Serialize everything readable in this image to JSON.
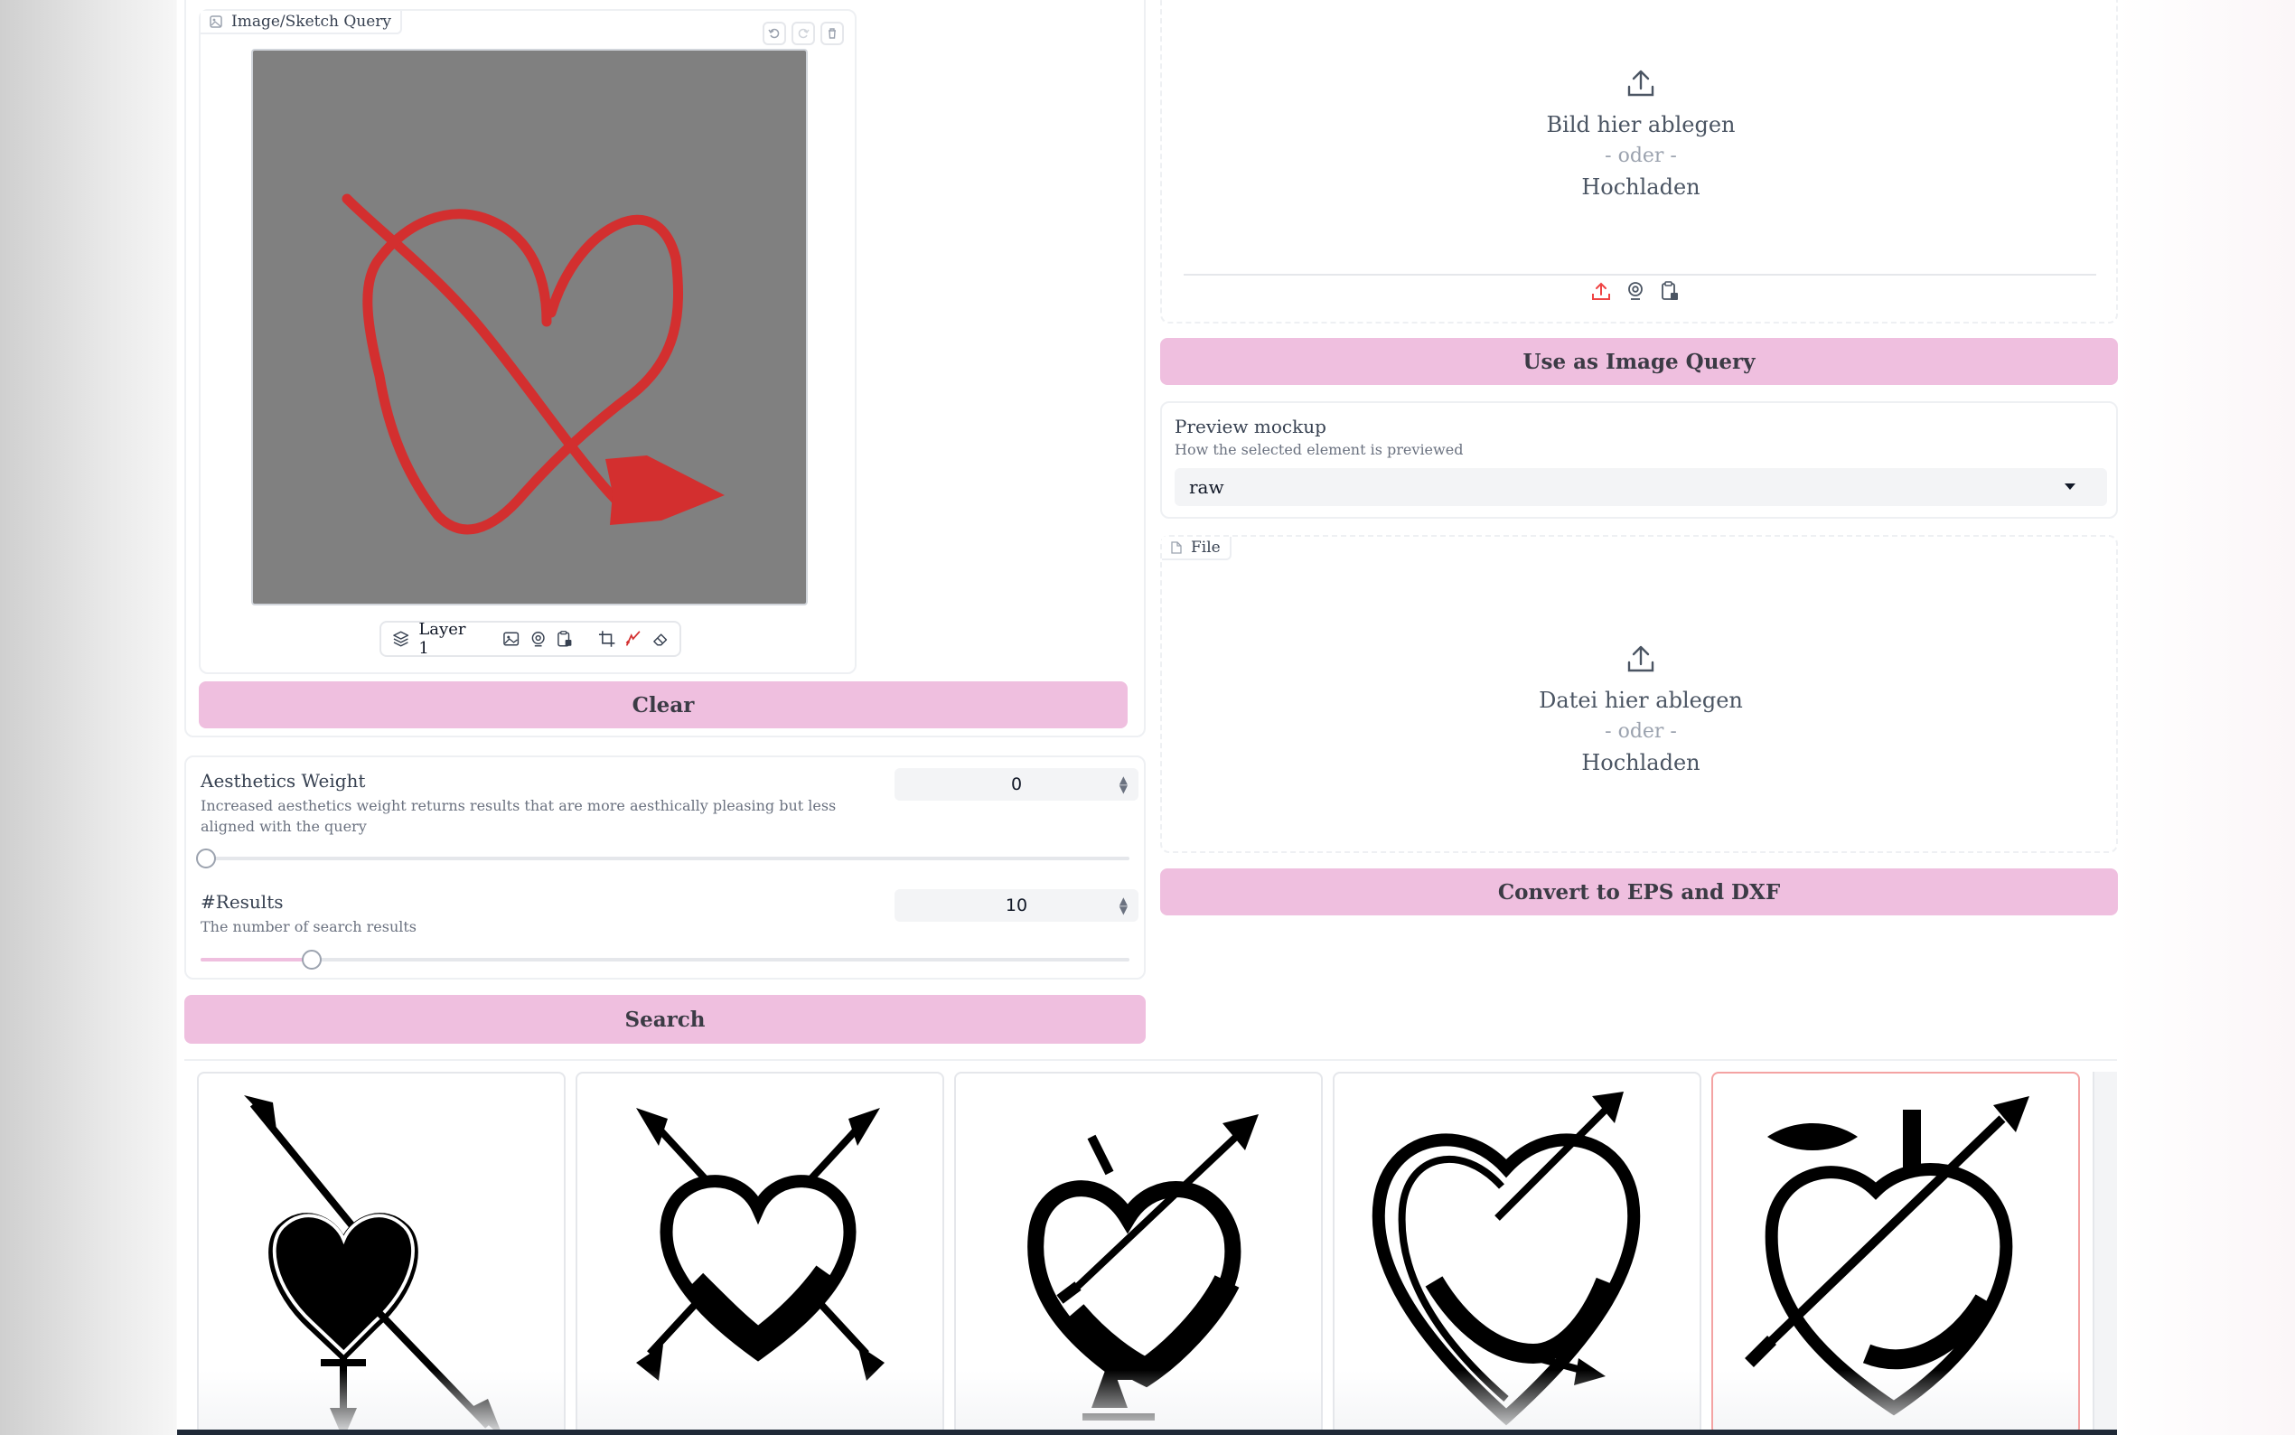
{
  "sketch_panel": {
    "label": "Image/Sketch Query",
    "layer_label": "Layer 1",
    "canvas_color": "#808080",
    "stroke_color": "#d32f2f"
  },
  "buttons": {
    "clear": "Clear",
    "search": "Search",
    "use_as_query": "Use as Image Query",
    "convert": "Convert to EPS and DXF"
  },
  "aesthetics": {
    "label": "Aesthetics Weight",
    "info": "Increased aesthetics weight returns results that are more aesthically pleasing but less aligned with the query",
    "value": "0",
    "level": 0
  },
  "results": {
    "label": "#Results",
    "info": "The number of search results",
    "value": "10",
    "level": 0.12
  },
  "image_upload": {
    "drop_text": "Bild hier ablegen",
    "or_text": "- oder -",
    "upload_text": "Hochladen"
  },
  "preview": {
    "label": "Preview mockup",
    "info": "How the selected element is previewed",
    "selected": "raw"
  },
  "file_upload": {
    "label": "File",
    "drop_text": "Datei hier ablegen",
    "or_text": "- oder -",
    "upload_text": "Hochladen"
  },
  "gallery": {
    "items": [
      "heart-arrow-1",
      "heart-arrow-2",
      "heart-arrow-3",
      "heart-arrow-4",
      "heart-arrow-5"
    ],
    "selected_index": 4
  },
  "colors": {
    "accent": "#efbfdf",
    "selected_border": "#f4a3a3"
  }
}
